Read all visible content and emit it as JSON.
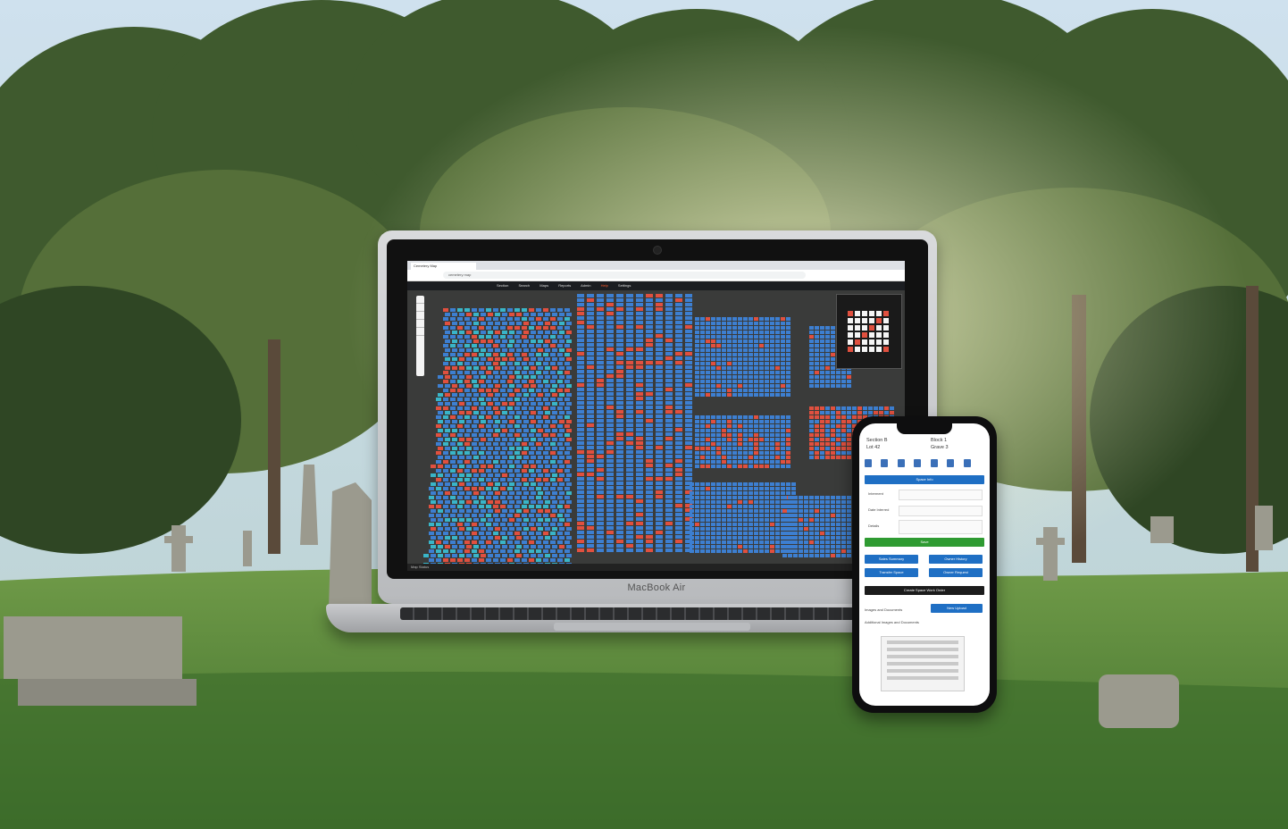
{
  "laptop": {
    "brand": "MacBook Air",
    "browser": {
      "tab_title": "Cemetery Map",
      "url": "cemetery map"
    },
    "app_menu": [
      "Section",
      "Search",
      "Maps",
      "Reports",
      "Admin",
      "Help",
      "Settings"
    ],
    "status_text": "Map Status"
  },
  "phone": {
    "header": {
      "left_line1": "Section B",
      "left_line2": "Lot 42",
      "right_line1": "Block 1",
      "right_line2": "Grave 3"
    },
    "space_info_button": "Space Info",
    "field_labels": {
      "interment": "Interment",
      "date": "Date Interred",
      "details": "Details"
    },
    "buttons": {
      "save": "Save",
      "sales": "Sales Summary",
      "history": "Owner History",
      "transfer": "Transfer Space",
      "request": "Owner Request",
      "work_order": "Create Space Work Order",
      "upload": "New Upload"
    },
    "section_labels": {
      "images": "Images and Documents",
      "additional": "Additional Images and Documents"
    }
  },
  "colors": {
    "plot_blue": "#3d7fd1",
    "plot_red": "#e0503f",
    "plot_teal": "#39b5c8",
    "accent_blue": "#1f6fc4",
    "accent_green": "#2f9b32"
  }
}
